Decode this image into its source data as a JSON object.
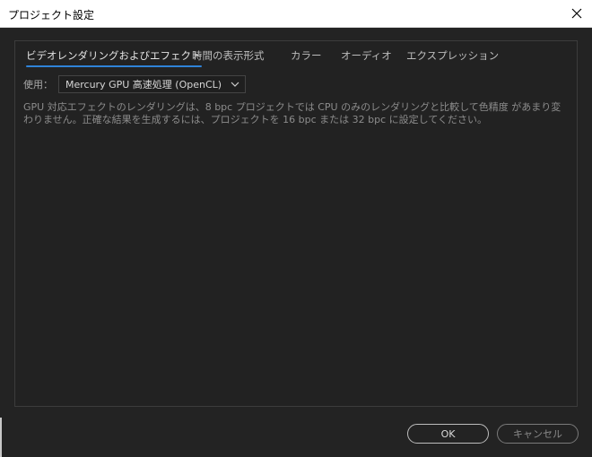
{
  "window": {
    "title": "プロジェクト設定",
    "close_icon": "close-icon"
  },
  "tabs": [
    {
      "label": "ビデオレンダリングおよびエフェクト",
      "active": true
    },
    {
      "label": "時間の表示形式",
      "active": false
    },
    {
      "label": "カラー",
      "active": false
    },
    {
      "label": "オーディオ",
      "active": false
    },
    {
      "label": "エクスプレッション",
      "active": false
    }
  ],
  "renderer": {
    "label": "使用：",
    "selected": "Mercury GPU 高速処理 (OpenCL)",
    "chevron_icon": "chevron-down-icon"
  },
  "description": "GPU 対応エフェクトのレンダリングは、8 bpc プロジェクトでは CPU のみのレンダリングと比較して色精度 があまり変わりません。正確な結果を生成するには、プロジェクトを 16 bpc または 32 bpc に設定してください。",
  "buttons": {
    "ok": "OK",
    "cancel": "キャンセル"
  },
  "colors": {
    "background": "#232323",
    "tab_underline": "#2f83d8",
    "titlebar": "#ffffff"
  }
}
